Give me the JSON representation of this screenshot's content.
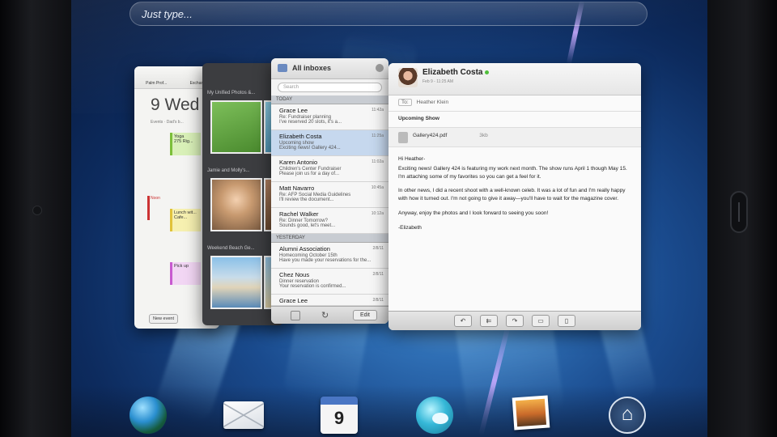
{
  "search": {
    "placeholder": "Just type..."
  },
  "calendar_card": {
    "top_tabs": [
      "Palm Prof...",
      "Exchange",
      "Yahoo"
    ],
    "day_label": "9 Wed",
    "events_label": "Events",
    "events_sub": "Dad's b...",
    "event1": "Yoga",
    "event1_sub": "275 Rig...",
    "noon_label": "Noon",
    "event2": "Lunch wit...",
    "event2_sub": "Cafe...",
    "event3": "Pick up",
    "new_event": "New event"
  },
  "photos_card": {
    "album1": "My Unified Photos &...",
    "album2": "Jamie and Molly's...",
    "album3": "Weekend Beach Ge..."
  },
  "inbox": {
    "title": "All inboxes",
    "search_placeholder": "Search",
    "section_today": "TODAY",
    "section_yesterday": "YESTERDAY",
    "edit_label": "Edit",
    "messages_today": [
      {
        "name": "Grace Lee",
        "subject": "Re: Fundraiser planning",
        "preview": "I've reserved 20 slots, it's a...",
        "time": "11:42a"
      },
      {
        "name": "Elizabeth Costa",
        "subject": "Upcoming show",
        "preview": "Exciting news! Gallery 424...",
        "time": "11:25a"
      },
      {
        "name": "Karen Antonio",
        "subject": "Children's Center Fundraiser",
        "preview": "Please join us for a day of...",
        "time": "11:02a"
      },
      {
        "name": "Matt Navarro",
        "subject": "Re: AFP Social Media Guidelines",
        "preview": "I'll review the document...",
        "time": "10:45a"
      },
      {
        "name": "Rachel Walker",
        "subject": "Re: Dinner Tomorrow?",
        "preview": "Sounds good, let's meet...",
        "time": "10:12a"
      }
    ],
    "messages_yesterday": [
      {
        "name": "Alumni Association",
        "subject": "Homecoming October 15th",
        "preview": "Have you made your reservations for the...",
        "time": "2/8/11"
      },
      {
        "name": "Chez Nous",
        "subject": "Dinner reservation",
        "preview": "Your reservation is confirmed...",
        "time": "2/8/11"
      },
      {
        "name": "Grace Lee",
        "subject": "",
        "preview": "",
        "time": "2/8/11"
      }
    ]
  },
  "message": {
    "sender": "Elizabeth Costa",
    "date": "Feb 9 - 11:25 AM",
    "to_label": "To:",
    "to_value": "Heather Klein",
    "subject": "Upcoming Show",
    "attachment": "Gallery424.pdf",
    "attachment_size": "3kb",
    "body": [
      "Hi Heather-",
      "Exciting news! Gallery 424 is featuring my work next month. The show runs April 1 though May 15. I'm attaching some of my favorites so you can get a feel for it.",
      "In other news, I did a recent shoot with a well-known celeb. It was a lot of fun and I'm really happy with how it turned out. I'm not going to give it away—you'll have to wait for the magazine cover.",
      "Anyway, enjoy the photos and I look forward to seeing you soon!",
      "-Elizabeth"
    ],
    "toolbar": [
      "reply",
      "reply-all",
      "forward",
      "move",
      "delete"
    ]
  },
  "dock": {
    "calendar_date": "9"
  }
}
